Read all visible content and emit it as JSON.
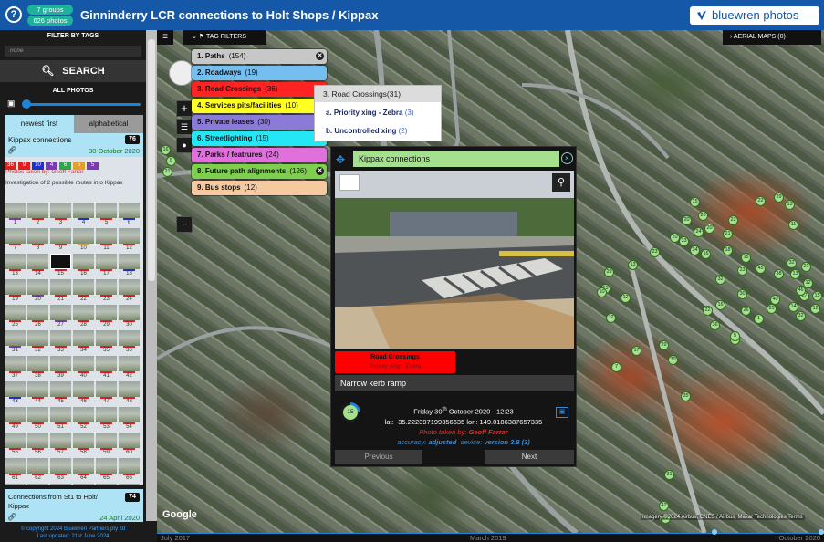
{
  "header": {
    "groups_pill": "7 groups",
    "photos_pill": "626 photos",
    "title": "Ginninderry LCR connections to Holt Shops / Kippax",
    "brand": "bluewren photos"
  },
  "sidebar": {
    "filter_heading": "FILTER BY TAGS",
    "tag_select_value": "none",
    "search_label": "SEARCH",
    "all_photos_label": "ALL PHOTOS",
    "sort_tabs": [
      "newest first",
      "alphabetical"
    ],
    "group": {
      "name": "Kippax connections",
      "count": "76",
      "date": "30 October 2020",
      "tag_counts": [
        {
          "n": "36",
          "color": "#e02020"
        },
        {
          "n": "9",
          "color": "#e02020"
        },
        {
          "n": "10",
          "color": "#1f2fd0"
        },
        {
          "n": "4",
          "color": "#7a3ab0"
        },
        {
          "n": "6",
          "color": "#2aa84a"
        },
        {
          "n": "5",
          "color": "#e0a030"
        },
        {
          "n": "5",
          "color": "#7a3ab0"
        }
      ],
      "photographer": "Photos taken by: Geoff Farrar",
      "description": "Investigation of 2 possible routes into Kippax"
    },
    "thumbnails": [
      {
        "n": "1",
        "c": "#7a3ab0"
      },
      {
        "n": "2",
        "c": "#e02020"
      },
      {
        "n": "3",
        "c": "#e02020"
      },
      {
        "n": "4",
        "c": "#1f2fd0"
      },
      {
        "n": "5",
        "c": "#e02020"
      },
      {
        "n": "6",
        "c": "#1f2fd0"
      },
      {
        "n": "7",
        "c": "#e02020"
      },
      {
        "n": "8",
        "c": "#e02020"
      },
      {
        "n": "9",
        "c": "#e02020"
      },
      {
        "n": "10",
        "c": "#e0a030"
      },
      {
        "n": "11",
        "c": "#e02020"
      },
      {
        "n": "12",
        "c": "#e02020"
      },
      {
        "n": "13",
        "c": "#e02020"
      },
      {
        "n": "14",
        "c": "#e02020"
      },
      {
        "n": "15",
        "c": "#e02020"
      },
      {
        "n": "16",
        "c": "#e02020"
      },
      {
        "n": "17",
        "c": "#e02020"
      },
      {
        "n": "18",
        "c": "#1f2fd0"
      },
      {
        "n": "19",
        "c": "#e02020"
      },
      {
        "n": "20",
        "c": "#7a3ab0"
      },
      {
        "n": "21",
        "c": "#e02020"
      },
      {
        "n": "22",
        "c": "#e02020"
      },
      {
        "n": "23",
        "c": "#e02020"
      },
      {
        "n": "24",
        "c": "#e02020"
      },
      {
        "n": "25",
        "c": "#e02020"
      },
      {
        "n": "26",
        "c": "#e02020"
      },
      {
        "n": "27",
        "c": "#7a3ab0"
      },
      {
        "n": "28",
        "c": "#e02020"
      },
      {
        "n": "29",
        "c": "#e02020"
      },
      {
        "n": "30",
        "c": "#e02020"
      },
      {
        "n": "31",
        "c": "#7a3ab0"
      },
      {
        "n": "32",
        "c": "#e02020"
      },
      {
        "n": "33",
        "c": "#e02020"
      },
      {
        "n": "34",
        "c": "#e02020"
      },
      {
        "n": "35",
        "c": "#e02020"
      },
      {
        "n": "36",
        "c": "#e02020"
      },
      {
        "n": "37",
        "c": "#e02020"
      },
      {
        "n": "38",
        "c": "#e02020"
      },
      {
        "n": "39",
        "c": "#e02020"
      },
      {
        "n": "40",
        "c": "#e02020"
      },
      {
        "n": "41",
        "c": "#e02020"
      },
      {
        "n": "42",
        "c": "#e02020"
      },
      {
        "n": "43",
        "c": "#1f2fd0"
      },
      {
        "n": "44",
        "c": "#e02020"
      },
      {
        "n": "45",
        "c": "#e02020"
      },
      {
        "n": "46",
        "c": "#e02020"
      },
      {
        "n": "47",
        "c": "#e02020"
      },
      {
        "n": "48",
        "c": "#e02020"
      },
      {
        "n": "49",
        "c": "#e02020"
      },
      {
        "n": "50",
        "c": "#e02020"
      },
      {
        "n": "51",
        "c": "#e02020"
      },
      {
        "n": "52",
        "c": "#e02020"
      },
      {
        "n": "53",
        "c": "#e02020"
      },
      {
        "n": "54",
        "c": "#e02020"
      },
      {
        "n": "55",
        "c": "#e02020"
      },
      {
        "n": "56",
        "c": "#e02020"
      },
      {
        "n": "57",
        "c": "#e02020"
      },
      {
        "n": "58",
        "c": "#e02020"
      },
      {
        "n": "59",
        "c": "#e02020"
      },
      {
        "n": "60",
        "c": "#e02020"
      },
      {
        "n": "61",
        "c": "#e02020"
      },
      {
        "n": "62",
        "c": "#e02020"
      },
      {
        "n": "63",
        "c": "#e02020"
      },
      {
        "n": "64",
        "c": "#e02020"
      },
      {
        "n": "65",
        "c": "#e02020"
      },
      {
        "n": "66",
        "c": "#e02020"
      },
      {
        "n": "67",
        "c": "#e02020"
      },
      {
        "n": "68",
        "c": "#e02020"
      },
      {
        "n": "69",
        "c": "#e02020"
      },
      {
        "n": "70",
        "c": "#e02020"
      },
      {
        "n": "71",
        "c": "#e02020"
      },
      {
        "n": "72",
        "c": "#e02020"
      },
      {
        "n": "73",
        "c": "#e02020"
      },
      {
        "n": "74",
        "c": "#e02020"
      },
      {
        "n": "75",
        "c": "#e02020"
      },
      {
        "n": "76",
        "c": "#e02020"
      }
    ],
    "group2": {
      "name": "Connections from St1 to Holt/ Kippax",
      "count": "74",
      "date": "24 April 2020"
    },
    "footer_copyright": "© copyright 2024  Bluewren Partners pty ltd",
    "footer_updated": "Last updated: 21st June 2024"
  },
  "map": {
    "tag_filters_label": "TAG FILTERS",
    "aerial_label": "AERIAL MAPS (0)",
    "tags": [
      {
        "label": "1. Paths",
        "count": "(154)",
        "color": "#c7c7c7"
      },
      {
        "label": "2. Roadways",
        "count": "(19)",
        "color": "#74bff0"
      },
      {
        "label": "3. Road Crossings",
        "count": "(36)",
        "color": "#ff2323"
      },
      {
        "label": "4. Services pits/facilities",
        "count": "(10)",
        "color": "#ffff25"
      },
      {
        "label": "5. Private leases",
        "count": "(30)",
        "color": "#8b7ad8"
      },
      {
        "label": "6. Streetlighting",
        "count": "(15)",
        "color": "#25e6f5"
      },
      {
        "label": "7. Parks / featrures",
        "count": "(24)",
        "color": "#e070dc"
      },
      {
        "label": "8. Future path alignments",
        "count": "(126)",
        "color": "#7fcf4e"
      },
      {
        "label": "9. Bus stops",
        "count": "(12)",
        "color": "#f7c9a1"
      }
    ],
    "submenu": {
      "header": "3. Road Crossings",
      "header_count": "(31)",
      "items": [
        {
          "label": "a. Priority xing - Zebra",
          "count": "(3)"
        },
        {
          "label": "b. Uncontrolled xing",
          "count": "(2)"
        }
      ]
    },
    "popup": {
      "group_title": "Kippax connections",
      "tag_label": "Road Crossings",
      "tag_sub": "Priority xing - Zebra",
      "caption": "Narrow kerb ramp",
      "photo_number": "15",
      "date_pre": "Friday 30",
      "date_sup": "th",
      "date_post": " October 2020 - 12:23",
      "coords": "lat: -35.222397199356635 lon: 149.0186387657335",
      "photographer_label": "Photo taken by:",
      "photographer": "Geoff Farrar",
      "accuracy_label": "accuracy:",
      "accuracy": "adjusted",
      "device_label": "device:",
      "device": "version 3.8 (3)",
      "prev": "Previous",
      "next": "Next"
    },
    "attribution": "Imagery ©2024 Airbus, CNES / Airbus, Maxar Technologies",
    "terms": "Terms",
    "google": "Google",
    "clusters": [
      "16",
      "8",
      "21",
      "15",
      "20",
      "20",
      "22",
      "29",
      "13",
      "11",
      "23",
      "20",
      "33",
      "34",
      "24",
      "20",
      "23",
      "18",
      "15",
      "13",
      "29",
      "15",
      "12",
      "10",
      "11",
      "32",
      "32",
      "21",
      "13",
      "12",
      "15",
      "27",
      "38",
      "23",
      "32",
      "30",
      "16",
      "22",
      "26",
      "25",
      "14",
      "12",
      "1",
      "3",
      "30",
      "35",
      "32",
      "5",
      "17",
      "7",
      "29",
      "36",
      "16",
      "21",
      "31",
      "42",
      "22",
      "45",
      "46",
      "40"
    ]
  },
  "timeline": {
    "start": "July 2017",
    "mid": "March 2019",
    "end": "October 2020"
  }
}
